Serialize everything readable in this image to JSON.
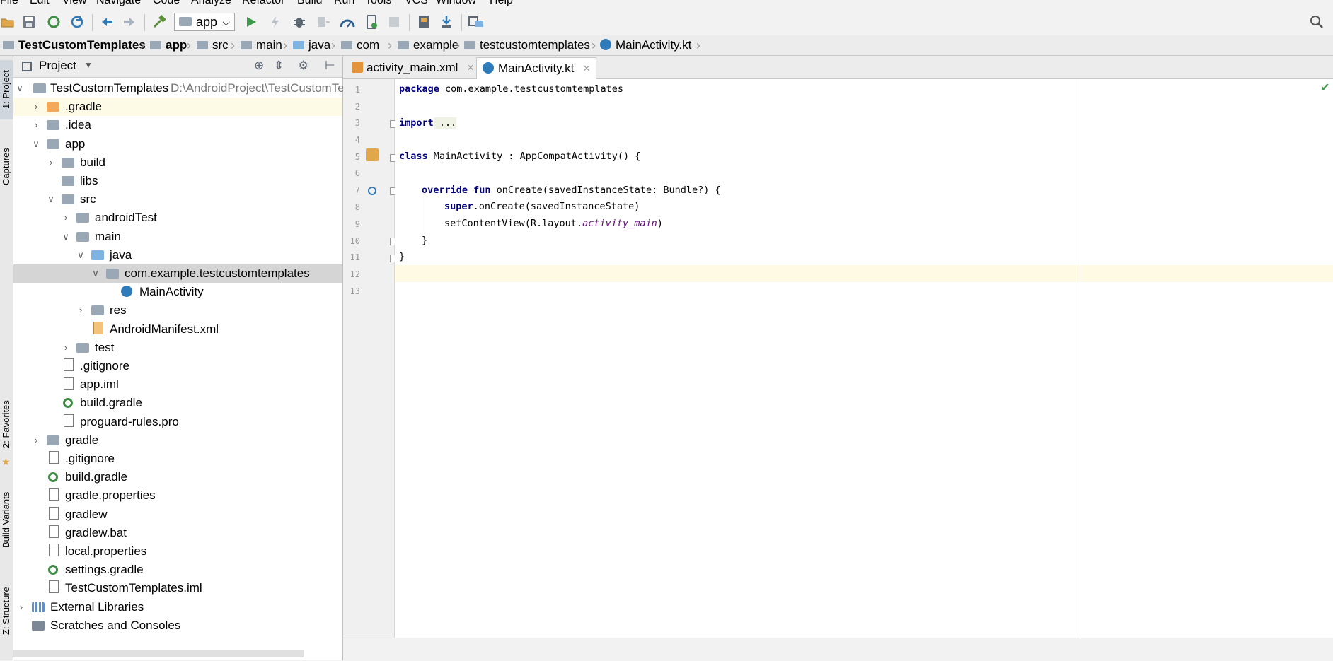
{
  "menu": [
    "File",
    "Edit",
    "View",
    "Navigate",
    "Code",
    "Analyze",
    "Refactor",
    "Build",
    "Run",
    "Tools",
    "VCS",
    "Window",
    "Help"
  ],
  "toolbar": {
    "run_config": "app",
    "icons": [
      "open-icon",
      "save-icon",
      "sync-icon",
      "refresh-icon",
      "back-icon",
      "forward-icon",
      "make-project-icon",
      "run-icon",
      "apply-changes-icon",
      "debug-icon",
      "attach-debugger-icon",
      "profile-icon",
      "avd-manager-icon",
      "stop-icon",
      "sdk-manager-icon",
      "download-icon",
      "project-structure-icon",
      "search-icon"
    ]
  },
  "breadcrumb": [
    "TestCustomTemplates",
    "app",
    "src",
    "main",
    "java",
    "com",
    "example",
    "testcustomtemplates",
    "MainActivity.kt"
  ],
  "side_tabs": {
    "project": "1: Project",
    "captures": "Captures",
    "favorites": "2: Favorites",
    "build_variants": "Build Variants",
    "structure": "Z: Structure"
  },
  "project_panel": {
    "title": "Project",
    "root_label": "TestCustomTemplates",
    "root_path": "D:\\AndroidProject\\TestCustomTe",
    "items": [
      {
        "label": ".gradle",
        "depth": 1,
        "icon": "folder-orange",
        "arrow": "right",
        "highlight": true
      },
      {
        "label": ".idea",
        "depth": 1,
        "icon": "folder",
        "arrow": "right"
      },
      {
        "label": "app",
        "depth": 1,
        "icon": "module-folder",
        "arrow": "down"
      },
      {
        "label": "build",
        "depth": 2,
        "icon": "folder",
        "arrow": "right"
      },
      {
        "label": "libs",
        "depth": 2,
        "icon": "folder",
        "arrow": ""
      },
      {
        "label": "src",
        "depth": 2,
        "icon": "folder",
        "arrow": "down"
      },
      {
        "label": "androidTest",
        "depth": 3,
        "icon": "folder",
        "arrow": "right"
      },
      {
        "label": "main",
        "depth": 3,
        "icon": "folder",
        "arrow": "down"
      },
      {
        "label": "java",
        "depth": 4,
        "icon": "folder-blue",
        "arrow": "down"
      },
      {
        "label": "com.example.testcustomtemplates",
        "depth": 5,
        "icon": "package",
        "arrow": "down",
        "selected": true
      },
      {
        "label": "MainActivity",
        "depth": 6,
        "icon": "kotlin-class",
        "arrow": ""
      },
      {
        "label": "res",
        "depth": 4,
        "icon": "res-folder",
        "arrow": "right"
      },
      {
        "label": "AndroidManifest.xml",
        "depth": 4,
        "icon": "manifest",
        "arrow": ""
      },
      {
        "label": "test",
        "depth": 3,
        "icon": "folder",
        "arrow": "right"
      },
      {
        "label": ".gitignore",
        "depth": 2,
        "icon": "file",
        "arrow": ""
      },
      {
        "label": "app.iml",
        "depth": 2,
        "icon": "file",
        "arrow": ""
      },
      {
        "label": "build.gradle",
        "depth": 2,
        "icon": "gradle",
        "arrow": ""
      },
      {
        "label": "proguard-rules.pro",
        "depth": 2,
        "icon": "file",
        "arrow": ""
      },
      {
        "label": "gradle",
        "depth": 1,
        "icon": "folder",
        "arrow": "right"
      },
      {
        "label": ".gitignore",
        "depth": 1,
        "icon": "file",
        "arrow": ""
      },
      {
        "label": "build.gradle",
        "depth": 1,
        "icon": "gradle",
        "arrow": ""
      },
      {
        "label": "gradle.properties",
        "depth": 1,
        "icon": "file",
        "arrow": ""
      },
      {
        "label": "gradlew",
        "depth": 1,
        "icon": "file",
        "arrow": ""
      },
      {
        "label": "gradlew.bat",
        "depth": 1,
        "icon": "file",
        "arrow": ""
      },
      {
        "label": "local.properties",
        "depth": 1,
        "icon": "file",
        "arrow": ""
      },
      {
        "label": "settings.gradle",
        "depth": 1,
        "icon": "gradle",
        "arrow": ""
      },
      {
        "label": "TestCustomTemplates.iml",
        "depth": 1,
        "icon": "file",
        "arrow": ""
      },
      {
        "label": "External Libraries",
        "depth": 0,
        "icon": "libraries",
        "arrow": "right"
      },
      {
        "label": "Scratches and Consoles",
        "depth": 0,
        "icon": "scratches",
        "arrow": ""
      }
    ]
  },
  "editor_tabs": [
    {
      "label": "activity_main.xml",
      "active": false
    },
    {
      "label": "MainActivity.kt",
      "active": true
    }
  ],
  "code": {
    "line_numbers": [
      "1",
      "2",
      "3",
      "4",
      "5",
      "6",
      "7",
      "8",
      "9",
      "10",
      "11",
      "12",
      "13"
    ],
    "l1_kw": "package",
    "l1_rest": " com.example.testcustomtemplates",
    "l3_kw": "import",
    "l3_rest": " ...",
    "l6_kw": "class",
    "l6_rest": " MainActivity : AppCompatActivity() {",
    "l8_kw": "override fun",
    "l8_rest": " onCreate(savedInstanceState: Bundle?) {",
    "l9_kw": "super",
    "l9_rest": ".onCreate(savedInstanceState)",
    "l10_pre": "setContentView(R.layout.",
    "l10_it": "activity_main",
    "l10_post": ")",
    "l11": "}",
    "l12": "}"
  }
}
